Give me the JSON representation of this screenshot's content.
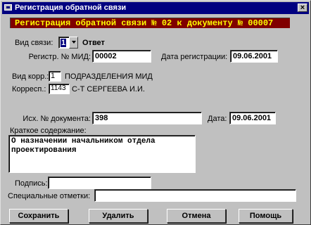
{
  "window": {
    "title": "Регистрация обратной связи",
    "close_glyph": "×"
  },
  "banner": "Регистрация обратной связи № 02 к документу № 00007",
  "form": {
    "vid_svyazi_label": "Вид связи:",
    "vid_svyazi_value": "1",
    "vid_svyazi_text": "Ответ",
    "reg_num_label": "Регистр. № МИД:",
    "reg_num_value": "00002",
    "reg_date_label": "Дата регистрации:",
    "reg_date_value": "09.06.2001",
    "vid_korr_label": "Вид корр.:",
    "vid_korr_value": "1",
    "vid_korr_text": "ПОДРАЗДЕЛЕНИЯ МИД",
    "korresp_label": "Корресп.:",
    "korresp_value": "1143",
    "korresp_text": "С-Т СЕРГЕЕВА И.И.",
    "iskh_num_label": "Исх. № документа:",
    "iskh_num_value": "398",
    "date_label": "Дата:",
    "date_value": "09.06.2001",
    "summary_label": "Краткое содержание:",
    "summary_value": "О назначении начальником отдела проектирования",
    "podpis_label": "Подпись:",
    "podpis_value": "",
    "spec_label": "Специальные отметки:",
    "spec_value": ""
  },
  "buttons": {
    "save": "Сохранить",
    "delete": "Удалить",
    "cancel": "Отмена",
    "help": "Помощь"
  },
  "colors": {
    "titlebar": "#000080",
    "banner_bg": "#800000",
    "banner_text": "#ffff00",
    "face": "#c0c0c0"
  }
}
